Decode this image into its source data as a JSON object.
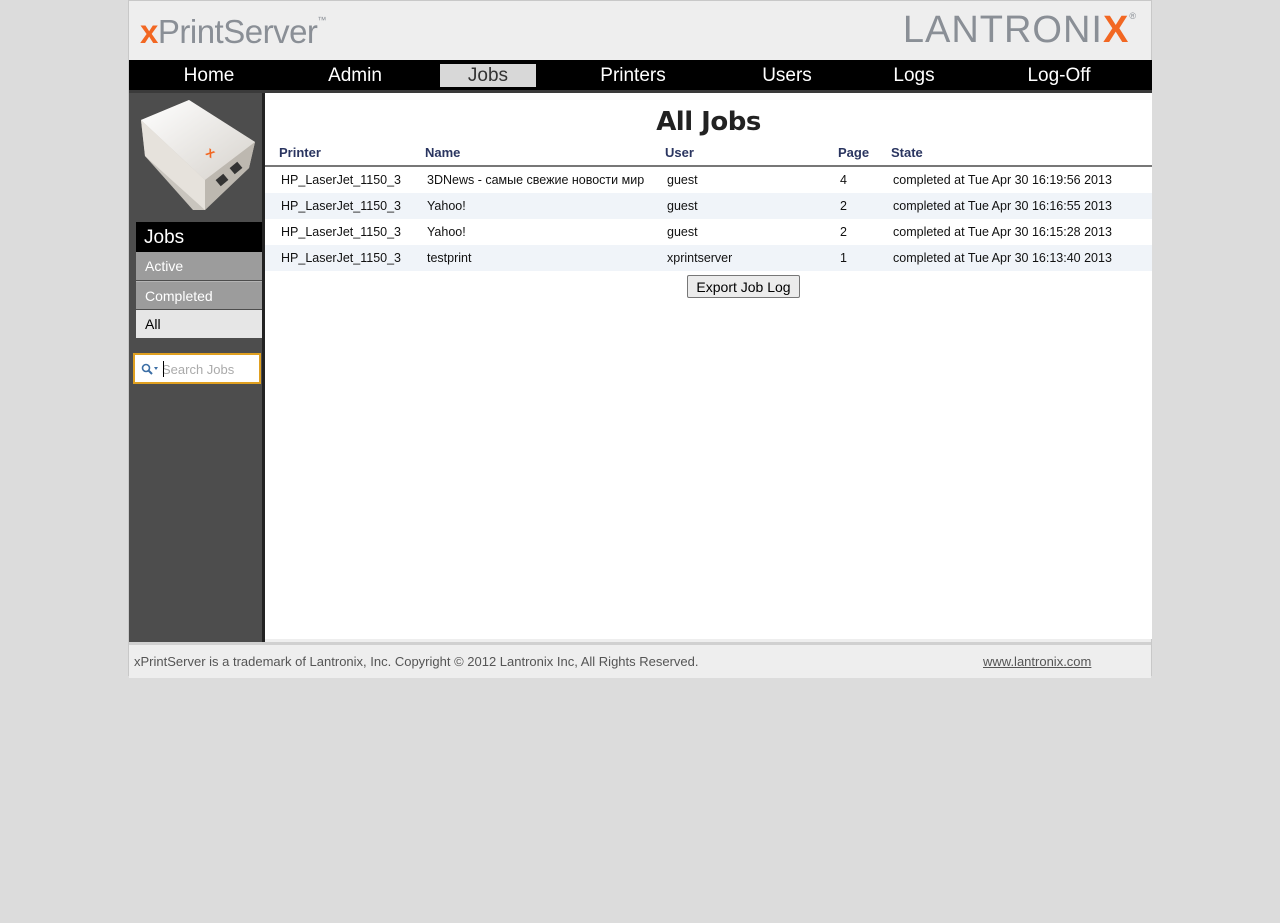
{
  "brand": {
    "left_logo_accent": "x",
    "left_logo_rest": "PrintServer",
    "left_logo_tm": "™",
    "right_logo_main": "LANTRONI",
    "right_logo_accent": "X",
    "right_logo_reg": "®",
    "accent_color": "#f26722"
  },
  "nav": {
    "items": [
      {
        "label": "Home"
      },
      {
        "label": "Admin"
      },
      {
        "label": "Jobs",
        "active": true
      },
      {
        "label": "Printers"
      },
      {
        "label": "Users"
      },
      {
        "label": "Logs"
      },
      {
        "label": "Log-Off"
      }
    ]
  },
  "sidebar": {
    "heading": "Jobs",
    "items": [
      {
        "label": "Active"
      },
      {
        "label": "Completed"
      },
      {
        "label": "All",
        "selected": true
      }
    ],
    "search_placeholder": "Search Jobs",
    "search_value": ""
  },
  "main": {
    "title": "All Jobs",
    "columns": [
      "Printer",
      "Name",
      "User",
      "Page",
      "State"
    ],
    "rows": [
      [
        "HP_LaserJet_1150_3",
        "3DNews - самые свежие новости мир",
        "guest",
        "4",
        "completed at Tue Apr 30 16:19:56 2013"
      ],
      [
        "HP_LaserJet_1150_3",
        "Yahoo!",
        "guest",
        "2",
        "completed at Tue Apr 30 16:16:55 2013"
      ],
      [
        "HP_LaserJet_1150_3",
        "Yahoo!",
        "guest",
        "2",
        "completed at Tue Apr 30 16:15:28 2013"
      ],
      [
        "HP_LaserJet_1150_3",
        "testprint",
        "xprintserver",
        "1",
        "completed at Tue Apr 30 16:13:40 2013"
      ]
    ],
    "export_label": "Export Job Log"
  },
  "footer": {
    "copyright": "xPrintServer is a trademark of Lantronix, Inc. Copyright © 2012 Lantronix Inc, All Rights Reserved.",
    "link": "www.lantronix.com"
  }
}
